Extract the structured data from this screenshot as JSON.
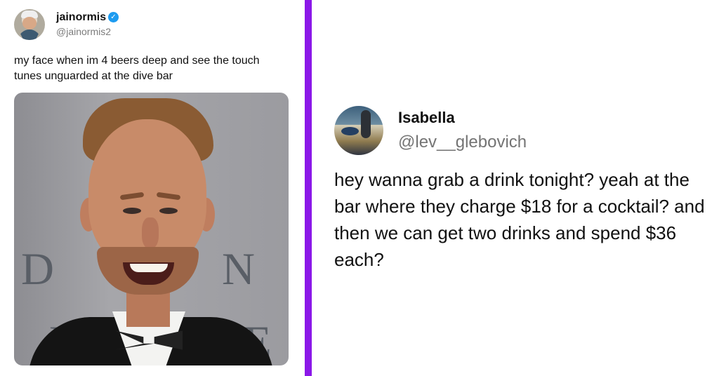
{
  "left_tweet": {
    "display_name": "jainormis",
    "verified_mark": "✓",
    "handle": "@jainormis2",
    "text": "my face when im 4 beers deep and see the touch tunes unguarded at the dive bar",
    "background_letters": {
      "line1_left": "D",
      "line1_right": "N",
      "line2_left": "L",
      "line2_right": "E"
    }
  },
  "right_tweet": {
    "display_name": "Isabella",
    "handle": "@lev__glebovich",
    "text": "hey wanna grab a drink tonight? yeah at the bar where they charge $18 for a cocktail? and then we can get two drinks and spend $36 each?"
  },
  "colors": {
    "divider": "#8b18e8",
    "verified_badge": "#1d9bf0"
  },
  "icons": {
    "verified": "verified-check-icon"
  }
}
